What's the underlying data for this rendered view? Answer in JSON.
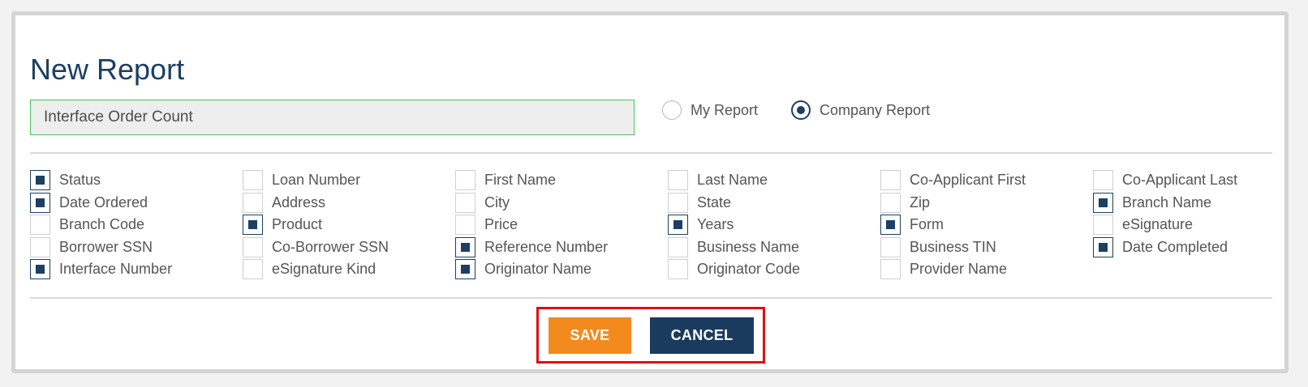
{
  "form": {
    "title": "New Report",
    "report_name_value": "Interface Order Count",
    "report_type_options": [
      {
        "label": "My Report",
        "selected": false
      },
      {
        "label": "Company Report",
        "selected": true
      }
    ]
  },
  "fields": [
    [
      {
        "label": "Status",
        "checked": true
      },
      {
        "label": "Date Ordered",
        "checked": true
      },
      {
        "label": "Branch Code",
        "checked": false
      },
      {
        "label": "Borrower SSN",
        "checked": false
      },
      {
        "label": "Interface Number",
        "checked": true
      }
    ],
    [
      {
        "label": "Loan Number",
        "checked": false
      },
      {
        "label": "Address",
        "checked": false
      },
      {
        "label": "Product",
        "checked": true
      },
      {
        "label": "Co-Borrower SSN",
        "checked": false
      },
      {
        "label": "eSignature Kind",
        "checked": false
      }
    ],
    [
      {
        "label": "First Name",
        "checked": false
      },
      {
        "label": "City",
        "checked": false
      },
      {
        "label": "Price",
        "checked": false
      },
      {
        "label": "Reference Number",
        "checked": true
      },
      {
        "label": "Originator Name",
        "checked": true
      }
    ],
    [
      {
        "label": "Last Name",
        "checked": false
      },
      {
        "label": "State",
        "checked": false
      },
      {
        "label": "Years",
        "checked": true
      },
      {
        "label": "Business Name",
        "checked": false
      },
      {
        "label": "Originator Code",
        "checked": false
      }
    ],
    [
      {
        "label": "Co-Applicant First",
        "checked": false
      },
      {
        "label": "Zip",
        "checked": false
      },
      {
        "label": "Form",
        "checked": true
      },
      {
        "label": "Business TIN",
        "checked": false
      },
      {
        "label": "Provider Name",
        "checked": false
      }
    ],
    [
      {
        "label": "Co-Applicant Last",
        "checked": false
      },
      {
        "label": "Branch Name",
        "checked": true
      },
      {
        "label": "eSignature",
        "checked": false
      },
      {
        "label": "Date Completed",
        "checked": true
      }
    ]
  ],
  "actions": {
    "save_label": "SAVE",
    "cancel_label": "CANCEL"
  },
  "colors": {
    "primary": "#1c3f63",
    "accent": "#f28a1e",
    "highlight_border": "#e01010",
    "input_border": "#4cc35b"
  }
}
